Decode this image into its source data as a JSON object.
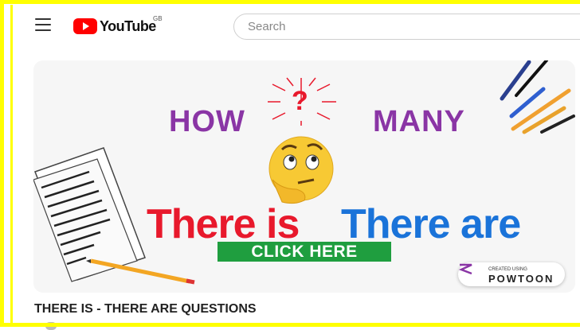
{
  "header": {
    "logo_text": "YouTube",
    "region": "GB",
    "search_placeholder": "Search"
  },
  "video": {
    "thumbnail": {
      "word_how": "HOW",
      "word_many": "MANY",
      "question_mark": "?",
      "text_there_is": "There is",
      "text_there_are": "There are",
      "cta_label": "CLICK HERE",
      "badge_small": "CREATED USING",
      "badge_name": "POWTOON"
    },
    "title": "THERE IS - THERE ARE QUESTIONS"
  },
  "colors": {
    "frame": "#ffff00",
    "youtube_red": "#ff0000",
    "purple": "#8a35a5",
    "red": "#e8192c",
    "blue": "#1a73d9",
    "green": "#1f9e3f"
  }
}
